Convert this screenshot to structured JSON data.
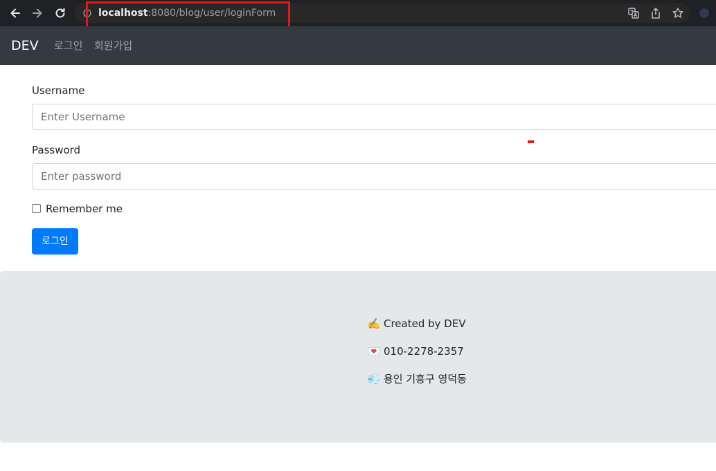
{
  "browser": {
    "url_host": "localhost",
    "url_path": ":8080/blog/user/loginForm",
    "icons": [
      "back-arrow-icon",
      "forward-arrow-icon",
      "reload-icon",
      "info-icon",
      "translate-icon",
      "share-icon",
      "bookmark-star-icon",
      "extension-icon"
    ]
  },
  "navbar": {
    "brand": "DEV",
    "links": [
      {
        "label": "로그인"
      },
      {
        "label": "회원가입"
      }
    ]
  },
  "form": {
    "username_label": "Username",
    "username_placeholder": "Enter Username",
    "username_value": "",
    "password_label": "Password",
    "password_placeholder": "Enter password",
    "password_value": "",
    "remember_label": "Remember me",
    "remember_checked": false,
    "submit_label": "로그인"
  },
  "footer": {
    "lines": [
      {
        "emoji": "✍️",
        "text": "Created by DEV"
      },
      {
        "emoji": "💌",
        "text": "010-2278-2357"
      },
      {
        "emoji": "💨",
        "text": "용인 기흥구 영덕동"
      }
    ]
  },
  "colors": {
    "navbar_bg": "#343a40",
    "primary_button": "#007bff",
    "footer_bg": "#e5e8eb",
    "highlight_box": "#e5151a"
  }
}
